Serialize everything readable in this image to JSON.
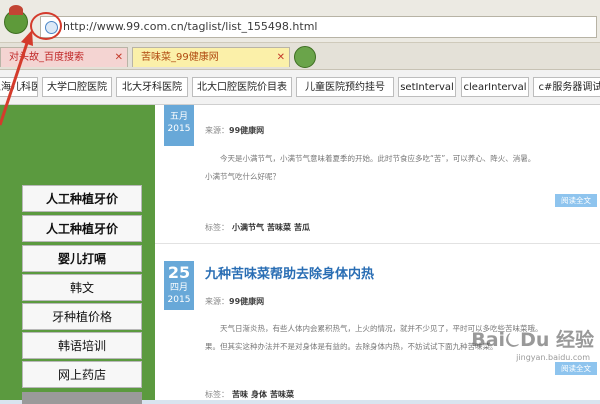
{
  "browser": {
    "url": "http://www.99.com.cn/taglist/list_155498.html",
    "tabs": [
      {
        "label": "对头故_百度搜索",
        "close": "✕"
      },
      {
        "label": "苦味菜_99健康网",
        "close": "✕"
      }
    ]
  },
  "bookmarks": [
    "上海儿科医院",
    "大学口腔医院",
    "北大牙科医院",
    "北大口腔医院价目表",
    "儿童医院预约挂号",
    "setInterval",
    "clearInterval",
    "c#服务器调试"
  ],
  "sidebar": {
    "items": [
      "人工种植牙价",
      "人工种植牙价",
      "婴儿打嗝",
      "韩文",
      "牙种植价格",
      "韩语培训",
      "网上药店"
    ]
  },
  "articles": [
    {
      "month": "五月",
      "year": "2015",
      "source_label": "来源：",
      "source": "99健康网",
      "summary_line1": "今天是小满节气，小满节气意味着夏季的开始。此时节食应多吃“苦”，可以养心、降火、消暑。",
      "summary_line2": "小满节气吃什么好呢？",
      "read_more": "阅读全文",
      "tags_label": "标签：",
      "tags": [
        "小满节气",
        "苦味菜",
        "苦瓜"
      ]
    },
    {
      "day": "25",
      "month": "四月",
      "year": "2015",
      "title": "九种苦味菜帮助去除身体内热",
      "source_label": "来源：",
      "source": "99健康网",
      "summary_line1": "天气日渐炎热，有些人体内会累积热气，上火的情况，就并不少见了，平时可以多吃些苦味菜哦。",
      "summary_line2": "果。但其实这种办法并不是对身体是有益的。去除身体内热，不妨试试下面九种苦味菜。",
      "read_more": "阅读全文",
      "tags_label": "标签：",
      "tags": [
        "苦味",
        "身体",
        "苦味菜"
      ]
    }
  ],
  "watermark": {
    "text": "Bai⏾Du 经验",
    "sub": "jingyan.baidu.com"
  }
}
